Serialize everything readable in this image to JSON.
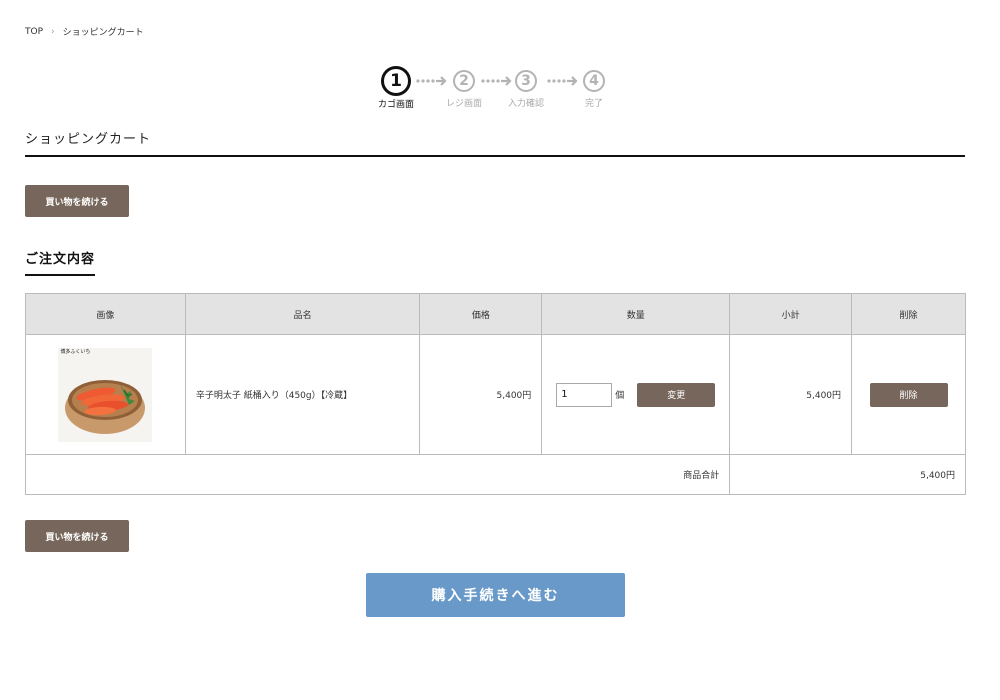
{
  "breadcrumb": {
    "top": "TOP",
    "current": "ショッピングカート"
  },
  "steps": [
    {
      "num": "1",
      "label": "カゴ画面"
    },
    {
      "num": "2",
      "label": "レジ画面"
    },
    {
      "num": "3",
      "label": "入力確認"
    },
    {
      "num": "4",
      "label": "完了"
    }
  ],
  "page_title": "ショッピングカート",
  "continue_label": "買い物を続ける",
  "section_title": "ご注文内容",
  "table": {
    "headers": {
      "image": "画像",
      "name": "品名",
      "price": "価格",
      "quantity": "数量",
      "subtotal": "小計",
      "delete": "削除"
    },
    "item": {
      "image_caption": "博多ふくいち",
      "name": "辛子明太子 紙桶入り（450g）【冷蔵】",
      "price": "5,400円",
      "quantity": "1",
      "unit": "個",
      "change_label": "変更",
      "subtotal": "5,400円",
      "delete_label": "削除"
    },
    "total_label": "商品合計",
    "total_value": "5,400円"
  },
  "purchase_label": "購入手続きへ進む",
  "colors": {
    "brown_button": "#76665b",
    "blue_button": "#6899c9",
    "header_bg": "#e3e3e3"
  }
}
